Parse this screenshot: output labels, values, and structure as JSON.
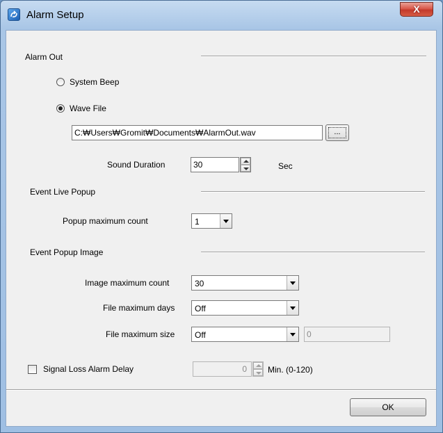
{
  "window": {
    "title": "Alarm Setup",
    "close_glyph": "X",
    "app_icon": "app-icon"
  },
  "alarm_out": {
    "title": "Alarm Out",
    "system_beep": {
      "label": "System Beep",
      "selected": false
    },
    "wave_file": {
      "label": "Wave File",
      "selected": true
    },
    "wave_path": "C:₩Users₩Gromit₩Documents₩AlarmOut.wav",
    "browse_label": "...",
    "sound_duration": {
      "label": "Sound Duration",
      "value": "30",
      "unit": "Sec"
    }
  },
  "event_live_popup": {
    "title": "Event Live Popup",
    "popup_max_count": {
      "label": "Popup maximum count",
      "value": "1"
    }
  },
  "event_popup_image": {
    "title": "Event Popup Image",
    "image_max_count": {
      "label": "Image maximum count",
      "value": "30"
    },
    "file_max_days": {
      "label": "File maximum days",
      "value": "Off"
    },
    "file_max_size": {
      "label": "File maximum size",
      "value": "Off",
      "extra_value": "0"
    }
  },
  "signal_loss": {
    "label": "Signal Loss Alarm Delay",
    "checked": false,
    "value": "0",
    "range_label": "Min. (0-120)"
  },
  "footer": {
    "ok_label": "OK"
  }
}
